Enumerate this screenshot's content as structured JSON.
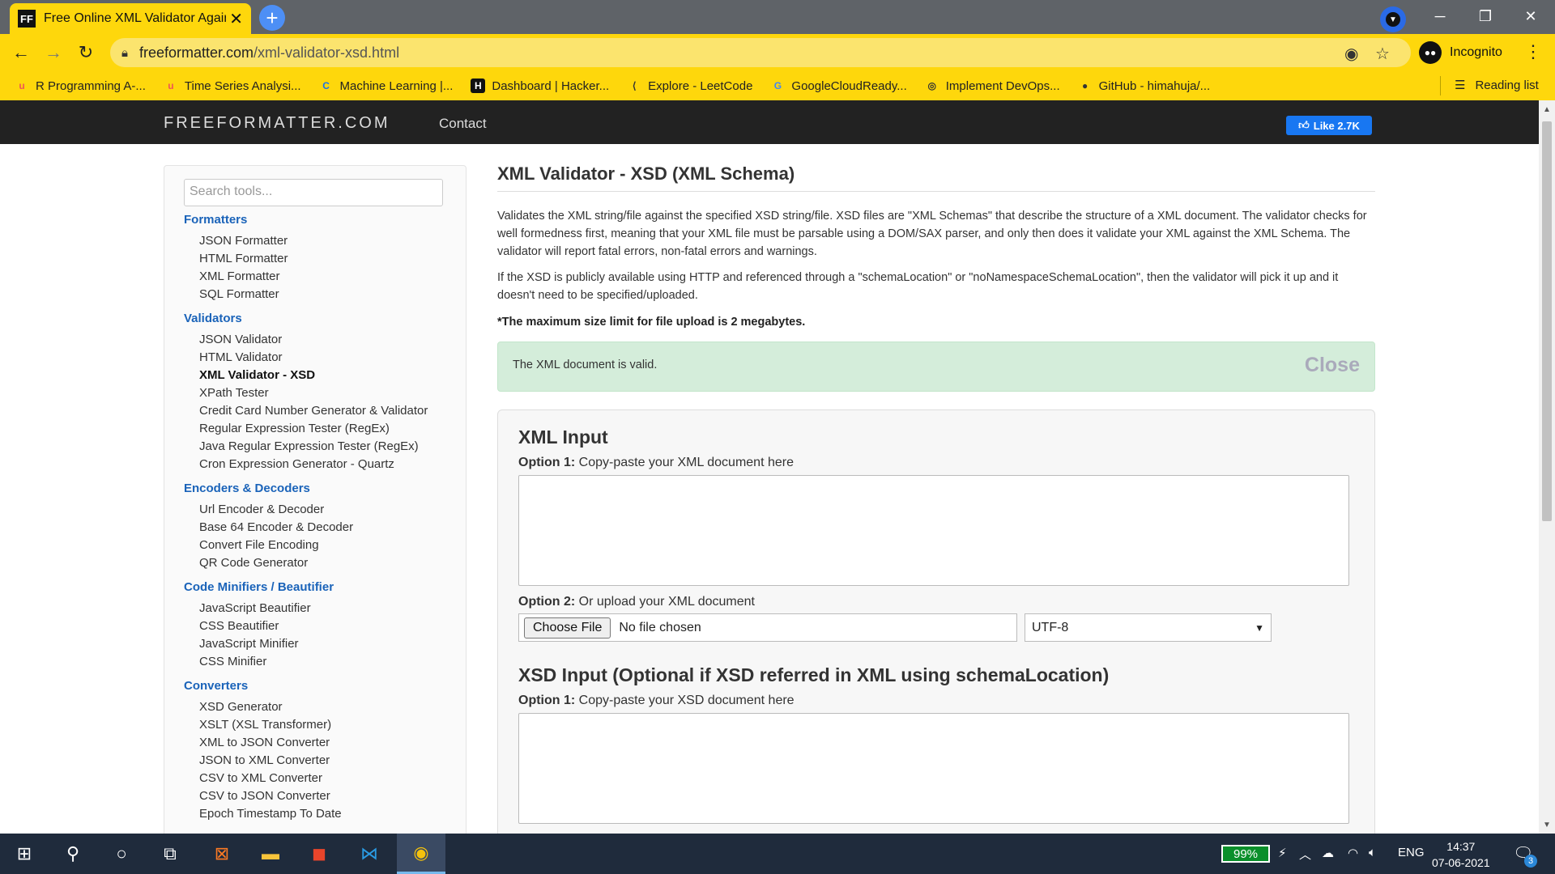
{
  "browser": {
    "tab_title": "Free Online XML Validator Against",
    "tab_favicon": "FF",
    "tab_close": "✕",
    "new_tab": "+",
    "url_domain": "freeformatter.com",
    "url_path": "/xml-validator-xsd.html",
    "profile_label": "Incognito",
    "window_controls": {
      "minimize": "─",
      "restore": "❐",
      "close": "✕"
    },
    "bookmarks": [
      {
        "label": "R Programming A-...",
        "icon": "u"
      },
      {
        "label": "Time Series Analysi...",
        "icon": "u"
      },
      {
        "label": "Machine Learning |...",
        "icon": "C"
      },
      {
        "label": "Dashboard | Hacker...",
        "icon": "H"
      },
      {
        "label": "Explore - LeetCode",
        "icon": "⟨"
      },
      {
        "label": "GoogleCloudReady...",
        "icon": "G"
      },
      {
        "label": "Implement DevOps...",
        "icon": "◎"
      },
      {
        "label": "GitHub - himahuja/...",
        "icon": "●"
      }
    ],
    "reading_list": "Reading list",
    "colors": {
      "chrome_accent": "#fed70c",
      "tab_strip": "#5f6368"
    }
  },
  "site": {
    "logo": "FREEFORMATTER.COM",
    "nav_contact": "Contact",
    "fb_like": "Like 2.7K"
  },
  "sidebar": {
    "search_placeholder": "Search tools...",
    "groups": [
      {
        "heading": "Formatters",
        "items": [
          "JSON Formatter",
          "HTML Formatter",
          "XML Formatter",
          "SQL Formatter"
        ]
      },
      {
        "heading": "Validators",
        "items": [
          "JSON Validator",
          "HTML Validator",
          "XML Validator - XSD",
          "XPath Tester",
          "Credit Card Number Generator & Validator",
          "Regular Expression Tester (RegEx)",
          "Java Regular Expression Tester (RegEx)",
          "Cron Expression Generator - Quartz"
        ]
      },
      {
        "heading": "Encoders & Decoders",
        "items": [
          "Url Encoder & Decoder",
          "Base 64 Encoder & Decoder",
          "Convert File Encoding",
          "QR Code Generator"
        ]
      },
      {
        "heading": "Code Minifiers / Beautifier",
        "items": [
          "JavaScript Beautifier",
          "CSS Beautifier",
          "JavaScript Minifier",
          "CSS Minifier"
        ]
      },
      {
        "heading": "Converters",
        "items": [
          "XSD Generator",
          "XSLT (XSL Transformer)",
          "XML to JSON Converter",
          "JSON to XML Converter",
          "CSV to XML Converter",
          "CSV to JSON Converter",
          "Epoch Timestamp To Date"
        ]
      }
    ]
  },
  "main": {
    "title": "XML Validator - XSD (XML Schema)",
    "desc1": "Validates the XML string/file against the specified XSD string/file. XSD files are \"XML Schemas\" that describe the structure of a XML document. The validator checks for well formedness first, meaning that your XML file must be parsable using a DOM/SAX parser, and only then does it validate your XML against the XML Schema. The validator will report fatal errors, non-fatal errors and warnings.",
    "desc2": "If the XSD is publicly available using HTTP and referenced through a \"schemaLocation\" or \"noNamespaceSchemaLocation\", then the validator will pick it up and it doesn't need to be specified/uploaded.",
    "note": "*The maximum size limit for file upload is 2 megabytes.",
    "alert_message": "The XML document is valid.",
    "alert_close": "Close",
    "xml_input": {
      "heading": "XML Input",
      "opt1_bold": "Option 1:",
      "opt1_text": " Copy-paste your XML document here",
      "opt1_value": "",
      "opt2_bold": "Option 2:",
      "opt2_text": " Or upload your XML document",
      "file_button": "Choose File",
      "file_status": "No file chosen",
      "encoding": "UTF-8"
    },
    "xsd_input": {
      "heading": "XSD Input (Optional if XSD referred in XML using schemaLocation)",
      "opt1_bold": "Option 1:",
      "opt1_text": " Copy-paste your XSD document here",
      "opt1_value": ""
    }
  },
  "taskbar": {
    "battery": "99%",
    "language": "ENG",
    "time": "14:37",
    "date": "07-06-2021",
    "notification_count": "3"
  }
}
